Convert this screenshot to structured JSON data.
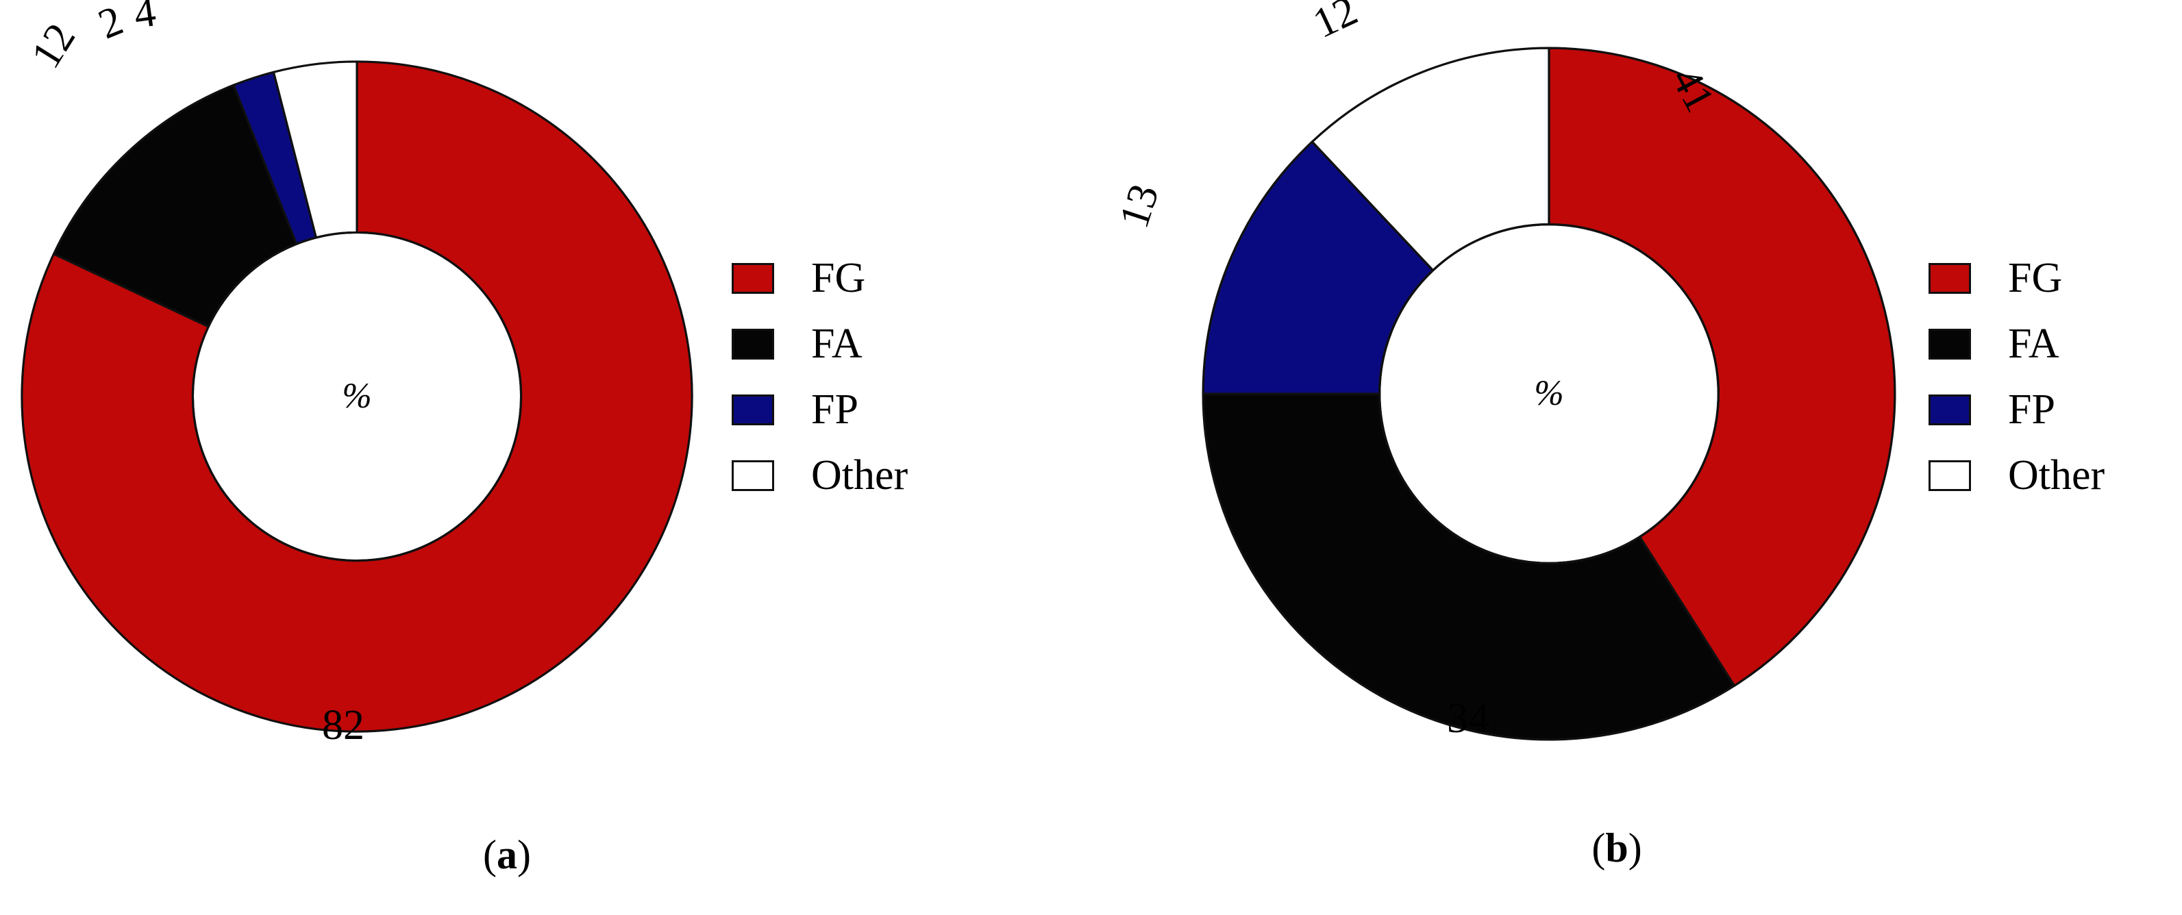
{
  "figure": {
    "background": "#ffffff",
    "colors": {
      "FG": "#c00808",
      "FA": "#050505",
      "FP": "#0a0a80",
      "Other": "#ffffff",
      "outline": "#101010"
    },
    "center_symbol": "%"
  },
  "panels": [
    {
      "id": "a",
      "caption_open": "(",
      "caption_letter": "a",
      "caption_close": ")",
      "center_symbol": "%",
      "legend": [
        {
          "label": "FG",
          "color": "#c00808"
        },
        {
          "label": "FA",
          "color": "#050505"
        },
        {
          "label": "FP",
          "color": "#0a0a80"
        },
        {
          "label": "Other",
          "color": "#ffffff"
        }
      ],
      "labels": [
        {
          "text": "82",
          "rotation": 0
        },
        {
          "text": "12",
          "rotation": -58
        },
        {
          "text": "2",
          "rotation": -22
        },
        {
          "text": "4",
          "rotation": -8
        }
      ]
    },
    {
      "id": "b",
      "caption_open": "(",
      "caption_letter": "b",
      "caption_close": ")",
      "center_symbol": "%",
      "legend": [
        {
          "label": "FG",
          "color": "#c00808"
        },
        {
          "label": "FA",
          "color": "#050505"
        },
        {
          "label": "FP",
          "color": "#0a0a80"
        },
        {
          "label": "Other",
          "color": "#ffffff"
        }
      ],
      "labels": [
        {
          "text": "41",
          "rotation": 62
        },
        {
          "text": "34",
          "rotation": 0
        },
        {
          "text": "13",
          "rotation": -72
        },
        {
          "text": "12",
          "rotation": -25
        }
      ]
    }
  ],
  "chart_data": [
    {
      "type": "pie",
      "variant": "donut",
      "panel": "a",
      "title": "(a)",
      "categories": [
        "FG",
        "FA",
        "FP",
        "Other"
      ],
      "values": [
        82,
        12,
        2,
        4
      ],
      "unit": "%",
      "center_label": "%",
      "colors": [
        "#c00808",
        "#050505",
        "#0a0a80",
        "#ffffff"
      ],
      "start_angle_deg": 0,
      "direction": "clockwise",
      "inner_radius_ratio": 0.49,
      "legend_position": "right",
      "data_labels": [
        "82",
        "12",
        "2",
        "4"
      ],
      "total": 100
    },
    {
      "type": "pie",
      "variant": "donut",
      "panel": "b",
      "title": "(b)",
      "categories": [
        "FG",
        "FA",
        "FP",
        "Other"
      ],
      "values": [
        41,
        34,
        13,
        12
      ],
      "unit": "%",
      "center_label": "%",
      "colors": [
        "#c00808",
        "#050505",
        "#0a0a80",
        "#ffffff"
      ],
      "start_angle_deg": 0,
      "direction": "clockwise",
      "inner_radius_ratio": 0.49,
      "legend_position": "right",
      "data_labels": [
        "41",
        "34",
        "13",
        "12"
      ],
      "total": 100
    }
  ]
}
